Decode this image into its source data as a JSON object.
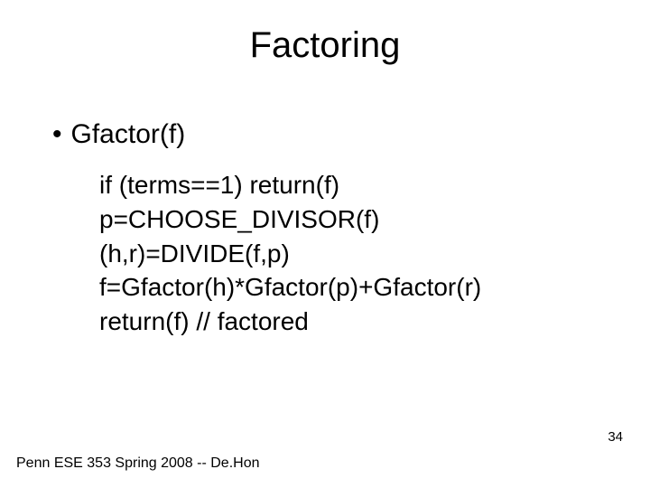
{
  "title": "Factoring",
  "bullet": {
    "marker": "•",
    "text": "Gfactor(f)"
  },
  "code": [
    "if (terms==1) return(f)",
    "p=CHOOSE_DIVISOR(f)",
    "(h,r)=DIVIDE(f,p)",
    "f=Gfactor(h)*Gfactor(p)+Gfactor(r)",
    "return(f) // factored"
  ],
  "page_number": "34",
  "footer": "Penn ESE 353 Spring 2008 -- De.Hon"
}
